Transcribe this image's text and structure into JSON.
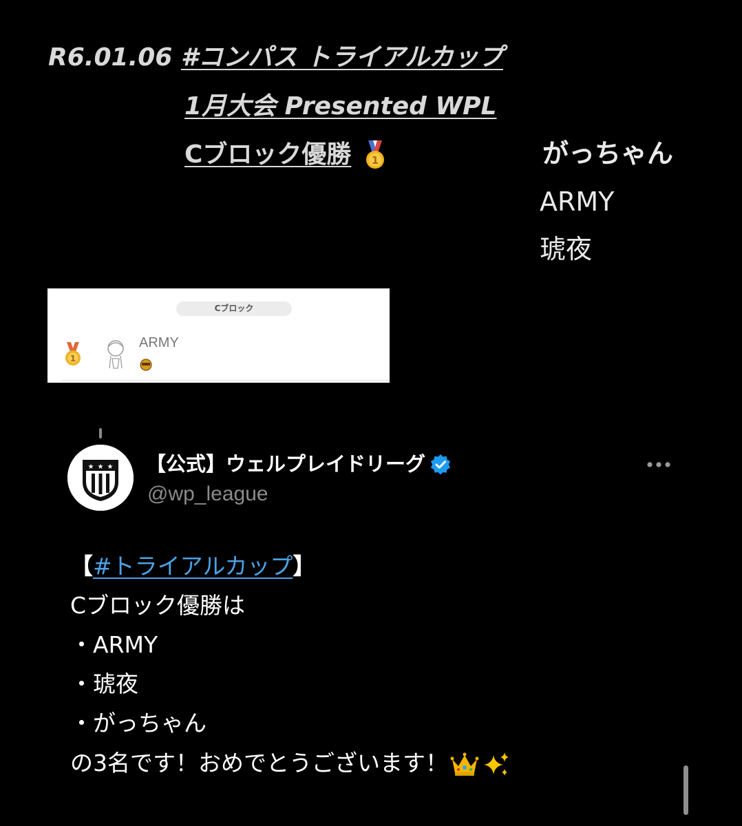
{
  "header": {
    "date": "R6.01.06",
    "line1_tag": "#コンパス トライアルカップ",
    "line2": "1月大会 Presented WPL",
    "line3": "Cブロック優勝"
  },
  "players": [
    "がっちゃん",
    "ARMY",
    "琥夜"
  ],
  "result_card": {
    "block_label": "Cブロック",
    "player_name": "ARMY"
  },
  "post": {
    "display_name": "【公式】ウェルプレイドリーグ",
    "handle": "@wp_league",
    "open_bracket": "【",
    "hashtag": "#トライアルカップ",
    "close_bracket": "】",
    "line2": "Cブロック優勝は",
    "line3": "・ARMY",
    "line4": "・琥夜",
    "line5": "・がっちゃん",
    "line6": "の3名です！おめでとうございます！"
  },
  "colors": {
    "background": "#000000",
    "hashtag": "#4aa3e8",
    "verified": "#1d9bf0",
    "handle": "#8b8b8b",
    "gold": "#f2b21c"
  },
  "icons": [
    "medal-1st-icon",
    "verified-badge-icon",
    "more-options-icon",
    "crown-icon",
    "sparkles-icon"
  ]
}
